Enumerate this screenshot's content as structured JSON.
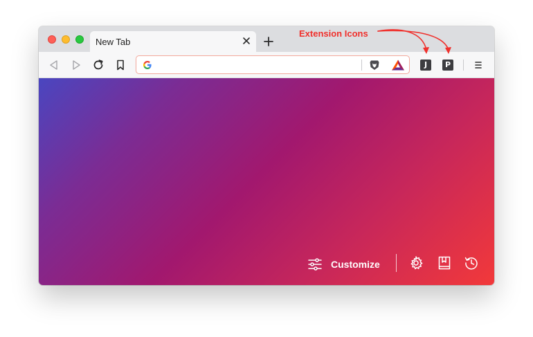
{
  "tab": {
    "title": "New Tab"
  },
  "address_bar": {
    "value": "",
    "placeholder": ""
  },
  "extensions": [
    {
      "letter": "J"
    },
    {
      "letter": "P"
    }
  ],
  "newtab": {
    "customize_label": "Customize"
  },
  "annotation": {
    "text": "Extension Icons"
  },
  "icons": {
    "back": "back-arrow-icon",
    "forward": "forward-arrow-icon",
    "reload": "reload-icon",
    "bookmark": "bookmark-icon",
    "search_engine": "google-g-icon",
    "shields": "brave-lion-icon",
    "rewards": "bat-triangle-icon",
    "menu": "hamburger-menu-icon",
    "customize": "sliders-icon",
    "settings": "gear-icon",
    "bookmarks": "bookmark-book-icon",
    "history": "history-clock-icon"
  },
  "colors": {
    "accent_annotation": "#f0302c",
    "gradient_start": "#4a46c0",
    "gradient_mid": "#a2186e",
    "gradient_end": "#f2393a",
    "address_border": "#f2a79b"
  }
}
